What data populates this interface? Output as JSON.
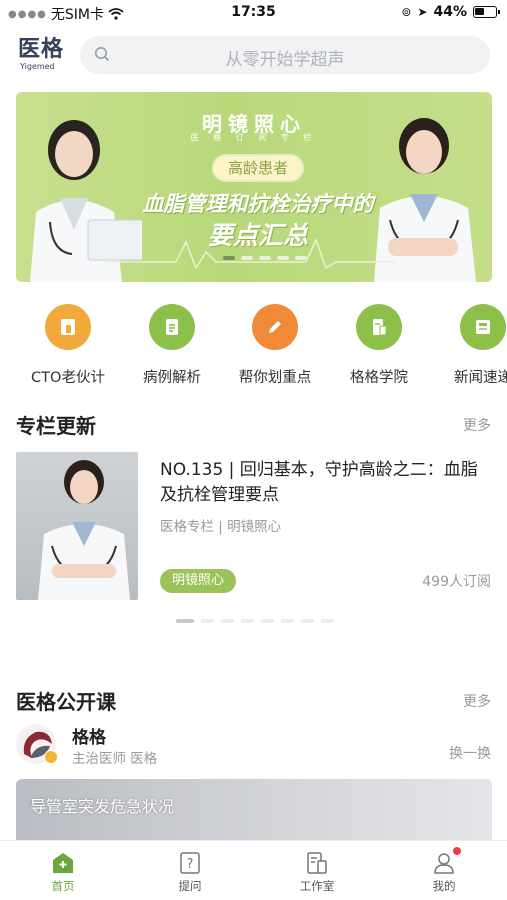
{
  "status_bar": {
    "carrier": "无SIM卡",
    "time": "17:35",
    "battery": "44%"
  },
  "header": {
    "logo_zh": "医格",
    "logo_en": "Yigemed",
    "search_placeholder": "从零开始学超声"
  },
  "banner": {
    "brand": "明镜照心",
    "brand_sub": "医 格 订 阅 专 栏",
    "pill": "高龄患者",
    "headline_1": "血脂管理和抗栓治疗中的",
    "headline_2": "要点汇总",
    "active_slide": 1,
    "slide_count": 5
  },
  "quick_nav": [
    {
      "label": "CTO老伙计",
      "icon": "cto-folder-icon",
      "color": "#f0a93a"
    },
    {
      "label": "病例解析",
      "icon": "clipboard-icon",
      "color": "#8cc04b"
    },
    {
      "label": "帮你划重点",
      "icon": "pencil-icon",
      "color": "#f08a38"
    },
    {
      "label": "格格学院",
      "icon": "document-icon",
      "color": "#8cc04b"
    },
    {
      "label": "新闻速递",
      "icon": "news-icon",
      "color": "#8cc04b"
    }
  ],
  "column_section": {
    "title": "专栏更新",
    "more": "更多",
    "item": {
      "title": "NO.135 | 回归基本，守护高龄之二：血脂及抗栓管理要点",
      "meta": "医格专栏 | 明镜照心",
      "tag": "明镜照心",
      "subscribers": "499人订阅"
    },
    "active_page": 1,
    "page_count": 8
  },
  "open_course": {
    "title": "医格公开课",
    "more": "更多",
    "teacher_name": "格格",
    "teacher_meta": "主治医师  医格",
    "refresh": "换一换",
    "course_title": "导管室突发危急状况"
  },
  "tab_bar": [
    {
      "label": "首页",
      "icon": "home-icon",
      "active": true
    },
    {
      "label": "提问",
      "icon": "question-icon",
      "active": false
    },
    {
      "label": "工作室",
      "icon": "workspace-icon",
      "active": false
    },
    {
      "label": "我的",
      "icon": "profile-icon",
      "active": false
    }
  ],
  "colors": {
    "brand_green": "#8cc04b",
    "tab_active": "#6aa83e",
    "badge_red": "#ec3b3b"
  }
}
